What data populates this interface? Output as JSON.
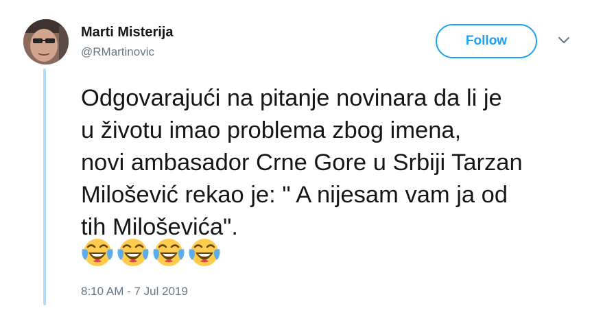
{
  "tweet": {
    "author": {
      "display_name": "Marti Misterija",
      "handle": "@RMartinovic",
      "avatar_icon": "profile-photo"
    },
    "follow_label": "Follow",
    "menu_icon": "chevron-down-icon",
    "text_lines": [
      "Odgovarajući na pitanje novinara da li je",
      "u životu imao problema zbog imena,",
      "novi ambasador Crne Gore u Srbiji Tarzan",
      "Milošević rekao je: \" A nijesam vam ja od",
      "tih Miloševića\"."
    ],
    "emojis": [
      "😂",
      "😂",
      "😂",
      "😂"
    ],
    "emoji_icon": "face-with-tears-of-joy",
    "timestamp": "8:10 AM - 7 Jul 2019"
  },
  "colors": {
    "accent": "#1da1f2",
    "thread_line": "#b5dcf7",
    "secondary_text": "#657786",
    "primary_text": "#14171a"
  }
}
